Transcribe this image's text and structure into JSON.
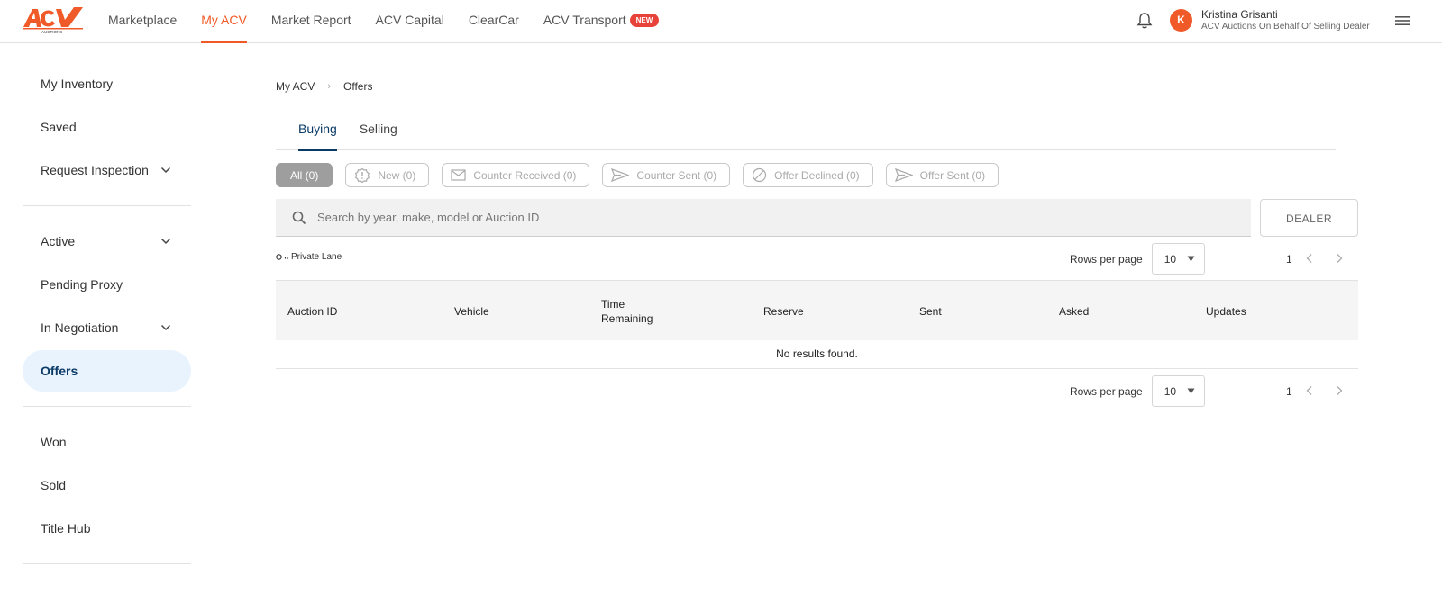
{
  "brand": {
    "accent": "#f05a28",
    "logo_caption": "AUCTIONS"
  },
  "nav": {
    "items": [
      {
        "label": "Marketplace",
        "active": false
      },
      {
        "label": "My ACV",
        "active": true
      },
      {
        "label": "Market Report",
        "active": false
      },
      {
        "label": "ACV Capital",
        "active": false
      },
      {
        "label": "ClearCar",
        "active": false
      },
      {
        "label": "ACV Transport",
        "active": false
      }
    ],
    "new_badge": "NEW"
  },
  "user": {
    "initial": "K",
    "name": "Kristina Grisanti",
    "org": "ACV Auctions On Behalf Of Selling Dealer"
  },
  "sidebar": {
    "group1": [
      {
        "label": "My Inventory"
      },
      {
        "label": "Saved"
      },
      {
        "label": "Request Inspection",
        "expandable": true
      }
    ],
    "group2": [
      {
        "label": "Active",
        "expandable": true
      },
      {
        "label": "Pending Proxy"
      },
      {
        "label": "In Negotiation",
        "expandable": true
      },
      {
        "label": "Offers",
        "active": true
      }
    ],
    "group3": [
      {
        "label": "Won"
      },
      {
        "label": "Sold"
      },
      {
        "label": "Title Hub"
      }
    ]
  },
  "breadcrumb": {
    "root": "My ACV",
    "current": "Offers"
  },
  "tabs": [
    {
      "label": "Buying",
      "active": true
    },
    {
      "label": "Selling",
      "active": false
    }
  ],
  "filters": [
    {
      "label": "All (0)",
      "active": true,
      "icon": "none"
    },
    {
      "label": "New (0)",
      "icon": "alert-badge-icon"
    },
    {
      "label": "Counter Received (0)",
      "icon": "envelope-icon"
    },
    {
      "label": "Counter Sent (0)",
      "icon": "send-icon"
    },
    {
      "label": "Offer Declined (0)",
      "icon": "block-icon"
    },
    {
      "label": "Offer Sent (0)",
      "icon": "send-icon"
    }
  ],
  "search": {
    "placeholder": "Search by year, make, model or Auction ID"
  },
  "dealer_button": "DEALER",
  "private_lane": "Private Lane",
  "pagination": {
    "rows_label": "Rows per page",
    "rows_value": "10",
    "page": "1"
  },
  "table": {
    "columns": [
      "Auction ID",
      "Vehicle",
      "Time Remaining",
      "Reserve",
      "Sent",
      "Asked",
      "Updates"
    ],
    "empty_text": "No results found."
  }
}
